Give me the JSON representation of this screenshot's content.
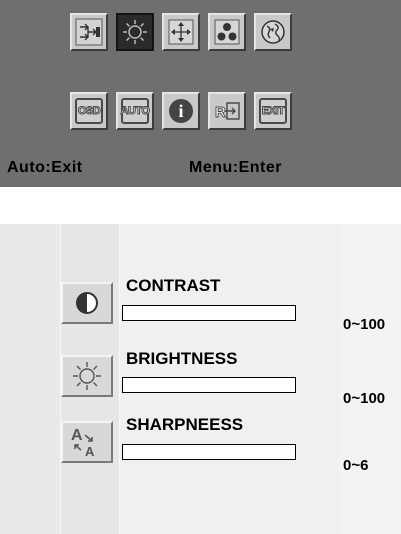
{
  "menu": {
    "row1_icons": [
      "input-source-icon",
      "brightness-icon",
      "position-icon",
      "color-icon",
      "language-icon"
    ],
    "row2_icons": [
      {
        "name": "osd-icon",
        "label": "OSD"
      },
      {
        "name": "auto-icon",
        "label": "AUTO"
      },
      {
        "name": "info-icon",
        "label": "i"
      },
      {
        "name": "recall-icon",
        "label": "R"
      },
      {
        "name": "exit-icon",
        "label": "EXIT"
      }
    ],
    "selected_icon": "brightness-icon",
    "hint_auto": "Auto:Exit",
    "hint_menu": "Menu:Enter"
  },
  "adjustments": [
    {
      "icon": "contrast-icon",
      "label": "CONTRAST",
      "range": "0~100",
      "level": 0
    },
    {
      "icon": "brightness-icon",
      "label": "BRIGHTNESS",
      "range": "0~100",
      "level": 0
    },
    {
      "icon": "sharpness-icon",
      "label": "SHARPNEESS",
      "range": "0~6",
      "level": 0
    }
  ],
  "colors": {
    "menu_background": "#6f6f6f",
    "icon_background": "#c9c9c9",
    "selected_icon_background": "#2b2b2b",
    "panel_background": "#efefef"
  }
}
